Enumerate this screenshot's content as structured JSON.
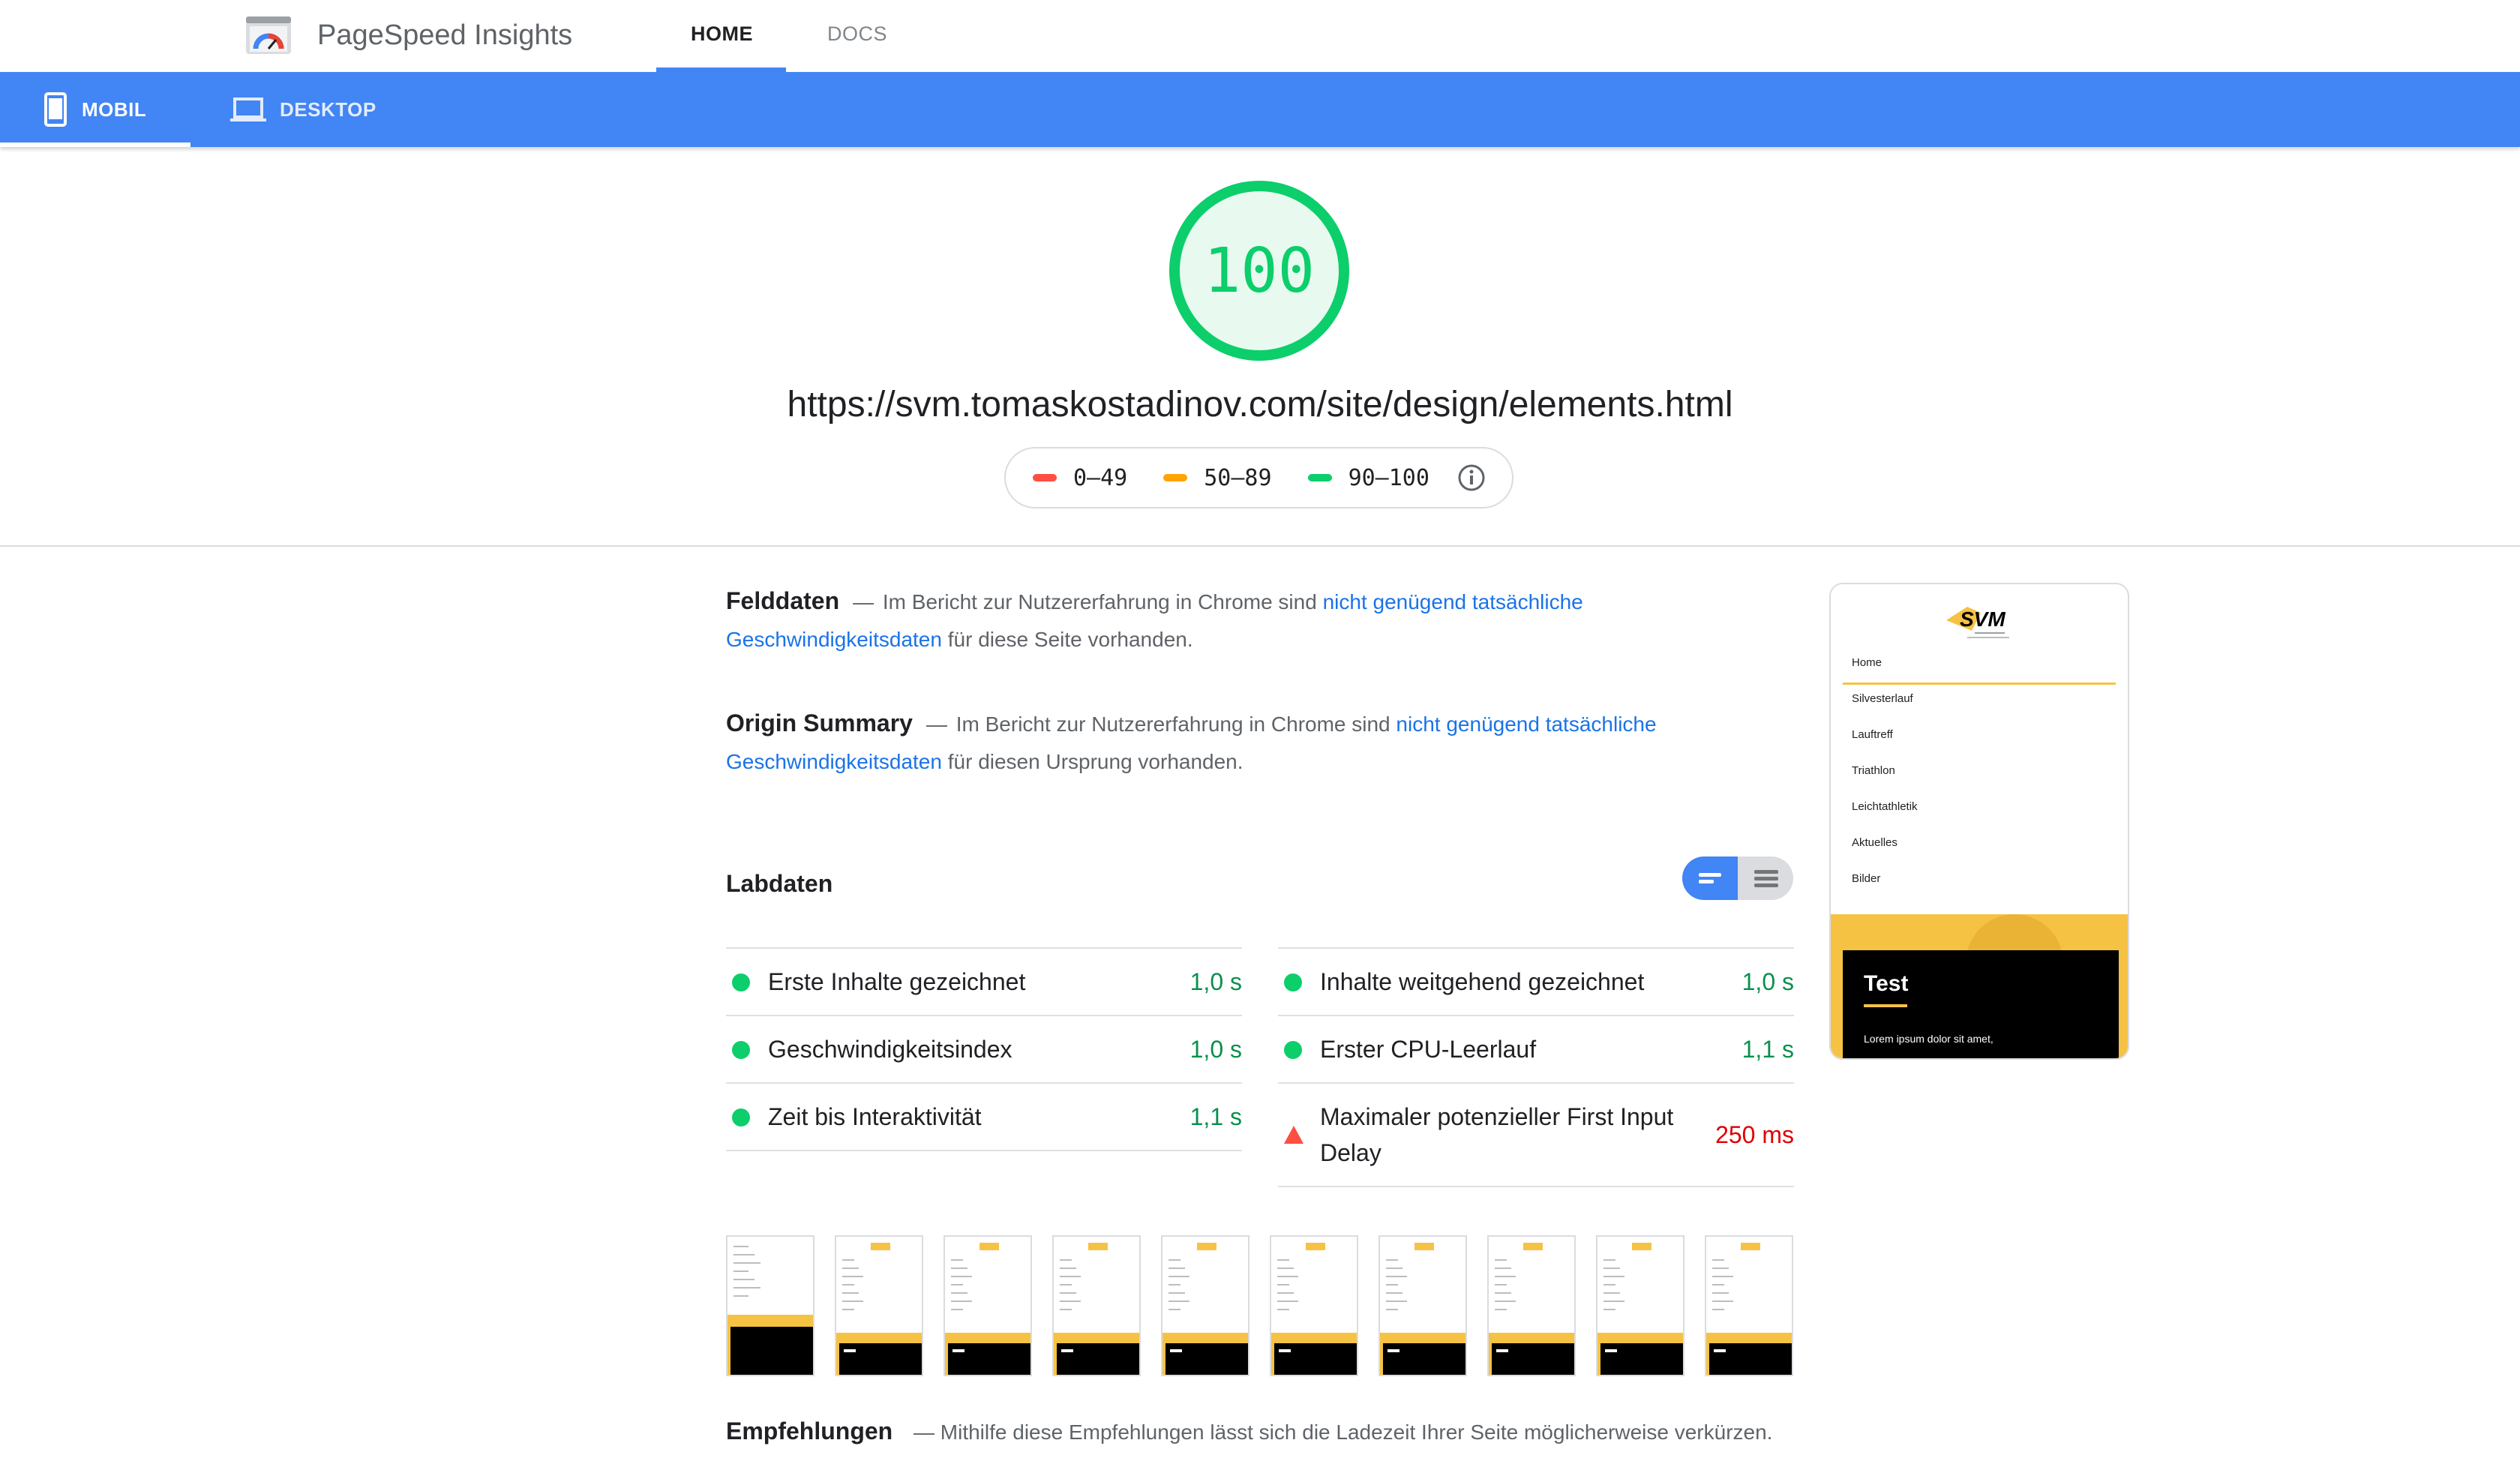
{
  "header": {
    "brand": "PageSpeed Insights",
    "tabs": [
      {
        "label": "HOME",
        "active": true
      },
      {
        "label": "DOCS",
        "active": false
      }
    ]
  },
  "device_tabs": [
    {
      "label": "MOBIL",
      "icon": "phone-icon",
      "active": true
    },
    {
      "label": "DESKTOP",
      "icon": "laptop-icon",
      "active": false
    }
  ],
  "score": {
    "value": "100",
    "color": "#0cce6b"
  },
  "url": "https://svm.tomaskostadinov.com/site/design/elements.html",
  "legend": [
    {
      "label": "0–49",
      "color": "#ff4e42"
    },
    {
      "label": "50–89",
      "color": "#ffa400"
    },
    {
      "label": "90–100",
      "color": "#0cce6b"
    }
  ],
  "felddaten": {
    "title": "Felddaten",
    "text_before": "Im Bericht zur Nutzererfahrung in Chrome sind",
    "link_line1": "nicht genügend tatsächliche",
    "link_line2": "Geschwindigkeitsdaten",
    "text_after": "für diese Seite vorhanden."
  },
  "origin": {
    "title": "Origin Summary",
    "text_before": "Im Bericht zur Nutzererfahrung in Chrome sind",
    "link_line1": "nicht genügend tatsächliche",
    "link_line2": "Geschwindigkeitsdaten",
    "text_after": "für diesen Ursprung vorhanden."
  },
  "labdaten": {
    "title": "Labdaten",
    "metrics_left": [
      {
        "name": "Erste Inhalte gezeichnet",
        "value": "1,0 s",
        "status": "pass"
      },
      {
        "name": "Geschwindigkeitsindex",
        "value": "1,0 s",
        "status": "pass"
      },
      {
        "name": "Zeit bis Interaktivität",
        "value": "1,1 s",
        "status": "pass"
      }
    ],
    "metrics_right": [
      {
        "name": "Inhalte weitgehend gezeichnet",
        "value": "1,0 s",
        "status": "pass"
      },
      {
        "name": "Erster CPU-Leerlauf",
        "value": "1,1 s",
        "status": "pass"
      },
      {
        "name_line1": "Maximaler potenzieller First Input",
        "name_line2": "Delay",
        "value": "250 ms",
        "status": "fail"
      }
    ]
  },
  "screenshot": {
    "logo_text": "SVM",
    "menu": [
      "Home",
      "Silvesterlauf",
      "Lauftreff",
      "Triathlon",
      "Leichtathletik",
      "Aktuelles",
      "Bilder"
    ],
    "card_title": "Test",
    "card_text": "Lorem ipsum dolor sit amet,"
  },
  "filmstrip_count": 10,
  "empfehlungen": {
    "title": "Empfehlungen",
    "text": "Mithilfe diese Empfehlungen lässt sich die Ladezeit Ihrer Seite möglicherweise verkürzen."
  }
}
